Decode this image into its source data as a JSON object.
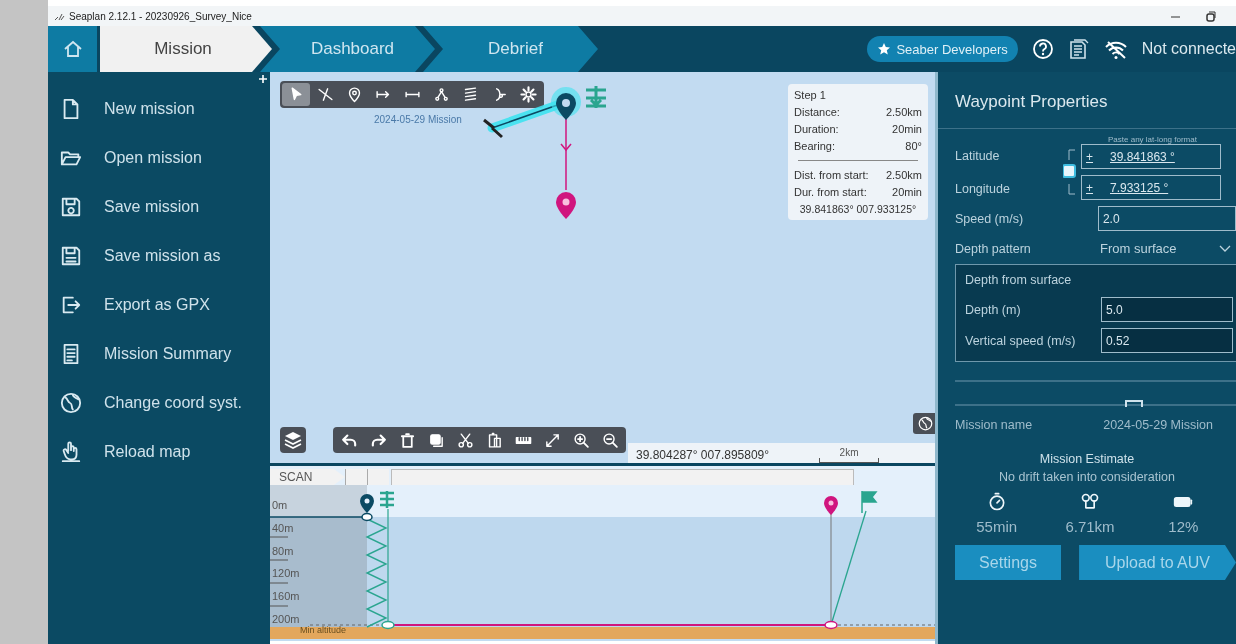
{
  "window": {
    "title": "Seaplan 2.12.1 - 20230926_Survey_Nice"
  },
  "nav": {
    "tabs": [
      {
        "label": "Mission",
        "selected": true
      },
      {
        "label": "Dashboard",
        "selected": false
      },
      {
        "label": "Debrief",
        "selected": false
      }
    ],
    "account": "Seaber Developers",
    "connection": "Not connecte"
  },
  "sidebar": {
    "items": [
      {
        "kind": "file",
        "label": "New mission"
      },
      {
        "kind": "folder",
        "label": "Open mission"
      },
      {
        "kind": "save",
        "label": "Save mission"
      },
      {
        "kind": "saveas",
        "label": "Save mission as"
      },
      {
        "kind": "export",
        "label": "Export as GPX"
      },
      {
        "kind": "summary",
        "label": "Mission Summary"
      },
      {
        "kind": "globe",
        "label": "Change coord syst."
      },
      {
        "kind": "reload",
        "label": "Reload map"
      }
    ]
  },
  "map": {
    "tools": [
      {
        "kind": "pointer",
        "selected": true
      },
      {
        "kind": "cutline",
        "selected": false
      },
      {
        "kind": "pin",
        "selected": false
      },
      {
        "kind": "arrowbar",
        "selected": false
      },
      {
        "kind": "line",
        "selected": false
      },
      {
        "kind": "branch",
        "selected": false
      },
      {
        "kind": "stack",
        "selected": false
      },
      {
        "kind": "fork",
        "selected": false
      },
      {
        "kind": "gear",
        "selected": false
      }
    ],
    "edit_tools": [
      {
        "kind": "undo"
      },
      {
        "kind": "redo"
      },
      {
        "kind": "trash"
      },
      {
        "kind": "copy"
      },
      {
        "kind": "scissors"
      },
      {
        "kind": "paste"
      },
      {
        "kind": "ruler"
      },
      {
        "kind": "expand"
      },
      {
        "kind": "zoomin"
      },
      {
        "kind": "zoomout"
      }
    ],
    "mission_label": "2024-05-29 Mission",
    "step_card": {
      "title": "Step 1",
      "rows": [
        {
          "label": "Distance:",
          "value": "2.50km"
        },
        {
          "label": "Duration:",
          "value": "20min"
        },
        {
          "label": "Bearing:",
          "value": "80°"
        }
      ],
      "totals": [
        {
          "label": "Dist. from start:",
          "value": "2.50km"
        },
        {
          "label": "Dur. from start:",
          "value": "20min"
        }
      ],
      "coords": "39.841863° 007.933125°"
    },
    "cursor_coords": "39.804287° 007.895809°",
    "scale": "2km"
  },
  "profile": {
    "tab": "SCAN",
    "depth_labels": [
      "0m",
      "40m",
      "80m",
      "120m",
      "160m",
      "200m"
    ],
    "floor_label": "Min altitude"
  },
  "properties": {
    "title": "Waypoint Properties",
    "hint": "Paste any lat-long format",
    "coordinates": [
      {
        "label": "Latitude",
        "sign": "+",
        "value": "39.841863 °"
      },
      {
        "label": "Longitude",
        "sign": "+",
        "value": "7.933125 °"
      }
    ],
    "speed": {
      "label": "Speed (m/s)",
      "value": "2.0"
    },
    "depth_pattern": {
      "label": "Depth pattern",
      "value": "From surface"
    },
    "depth_group": {
      "title": "Depth from surface",
      "fields": [
        {
          "label": "Depth (m)",
          "value": "5.0"
        },
        {
          "label": "Vertical speed (m/s)",
          "value": "0.52"
        }
      ]
    },
    "mission_name": {
      "label": "Mission name",
      "value": "2024-05-29 Mission"
    },
    "estimate": {
      "title": "Mission Estimate",
      "note": "No drift taken into consideration",
      "stats": [
        {
          "kind": "time",
          "value": "55min"
        },
        {
          "kind": "distance",
          "value": "6.71km"
        },
        {
          "kind": "battery",
          "value": "12%"
        }
      ]
    },
    "buttons": [
      {
        "kind": "plain",
        "label": "Settings"
      },
      {
        "kind": "arrow",
        "label": "Upload to AUV"
      }
    ]
  }
}
